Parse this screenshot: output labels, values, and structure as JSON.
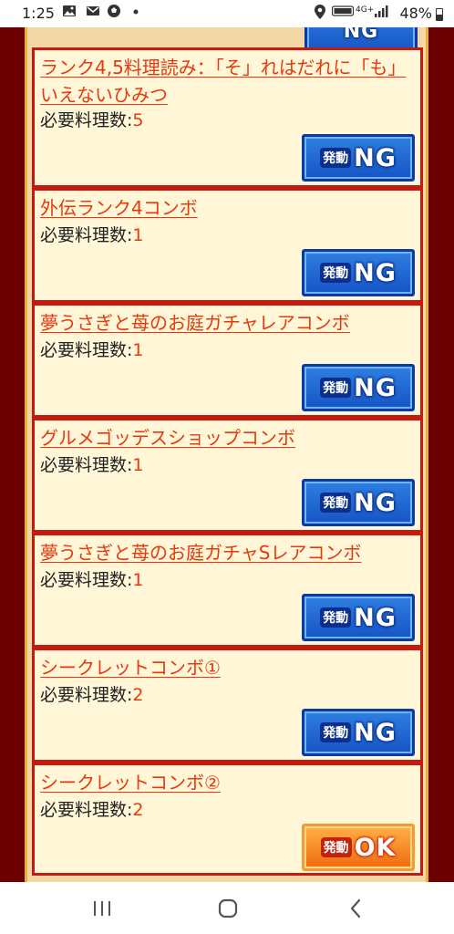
{
  "status_bar": {
    "time": "1:25",
    "battery": "48%",
    "battery_level": 0.48,
    "network": "4G+",
    "icons": [
      "image-icon",
      "message-icon",
      "soccer-ball-icon",
      "dot-icon",
      "location-icon",
      "volte-icon",
      "signal-icon",
      "battery-icon"
    ]
  },
  "combos": [
    {
      "title": "ランク4,5料理読み：「そ」れはだれに「も」いえないひみつ",
      "req_label": "必要料理数:",
      "req_count": "5",
      "status": "NG"
    },
    {
      "title": "外伝ランク4コンボ",
      "req_label": "必要料理数:",
      "req_count": "1",
      "status": "NG"
    },
    {
      "title": "夢うさぎと苺のお庭ガチャレアコンボ",
      "req_label": "必要料理数:",
      "req_count": "1",
      "status": "NG"
    },
    {
      "title": "グルメゴッデスショップコンボ",
      "req_label": "必要料理数:",
      "req_count": "1",
      "status": "NG"
    },
    {
      "title": "夢うさぎと苺のお庭ガチャSレアコンボ",
      "req_label": "必要料理数:",
      "req_count": "1",
      "status": "NG"
    },
    {
      "title": "シークレットコンボ①",
      "req_label": "必要料理数:",
      "req_count": "2",
      "status": "NG"
    },
    {
      "title": "シークレットコンボ②",
      "req_label": "必要料理数:",
      "req_count": "2",
      "status": "OK"
    }
  ],
  "button": {
    "prefix": "発動",
    "ng_word": "NG",
    "ok_word": "OK"
  },
  "colors": {
    "background": "#6b0000",
    "card_border": "#c61a10",
    "card_fill": "#fff7d8",
    "link": "#e8380d",
    "ng_button": "#1554c6",
    "ok_button": "#f06b10"
  },
  "nav": {
    "icons": [
      "recent-apps-icon",
      "home-icon",
      "back-icon"
    ]
  }
}
